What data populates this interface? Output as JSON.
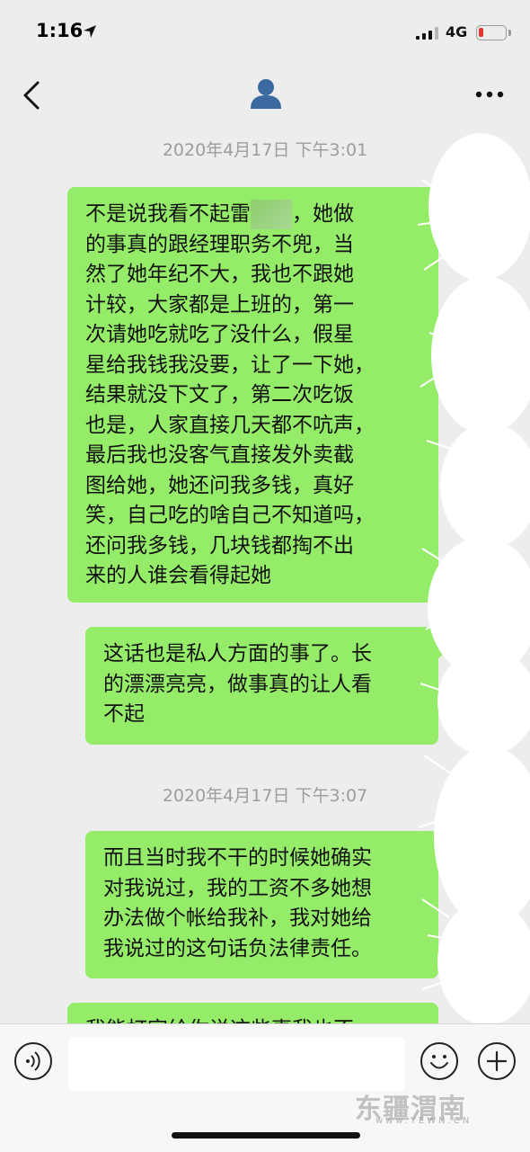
{
  "status_bar": {
    "time": "1:16",
    "network": "4G"
  },
  "chat": {
    "messages": [
      {
        "timestamp": "2020年4月17日 下午3:01",
        "text_a": "不是说我看不起雷",
        "text_b": "，她做\n的事真的跟经理职务不兜，当\n然了她年纪不大，我也不跟她\n计较，大家都是上班的，第一\n次请她吃就吃了没什么，假星\n星给我钱我没要，让了一下她，\n结果就没下文了，第二次吃饭\n也是，人家直接几天都不吭声，\n最后我也没客气直接发外卖截\n图给她，她还问我多钱，真好\n笑，自己吃的啥自己不知道吗，\n还问我多钱，几块钱都掏不出\n来的人谁会看得起她"
      },
      {
        "text": "这话也是私人方面的事了。长\n的漂漂亮亮，做事真的让人看\n不起"
      },
      {
        "timestamp": "2020年4月17日 下午3:07",
        "text": "而且当时我不干的时候她确实\n对我说过，我的工资不多她想\n办法做个帐给我补，我对她给\n我说过的这句话负法律责任。"
      },
      {
        "text": "我能打字给你说这些事我也不"
      }
    ]
  },
  "input_bar": {
    "placeholder": ""
  },
  "watermark": {
    "name": "东疆渭南",
    "url": "www.YEWN.CN"
  },
  "colors": {
    "bubble": "#95ec69",
    "background": "#ededed",
    "timestamp": "#9d9d9d",
    "battery_low": "#e5332f"
  }
}
